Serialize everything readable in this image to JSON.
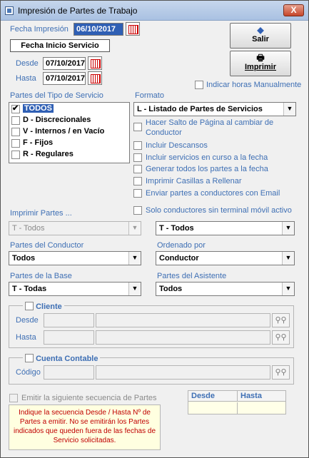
{
  "window": {
    "title": "Impresión de Partes de Trabajo",
    "close": "X"
  },
  "fecha_impresion": {
    "label": "Fecha Impresión",
    "value": "06/10/2017"
  },
  "fecha_inicio": {
    "label": "Fecha Inicio Servicio",
    "desde_label": "Desde",
    "desde": "07/10/2017",
    "hasta_label": "Hasta",
    "hasta": "07/10/2017"
  },
  "buttons": {
    "salir": "Salir",
    "imprimir": "Imprimir"
  },
  "indicar_horas": "Indicar horas Manualmente",
  "tipo_servicio": {
    "label": "Partes del Tipo de Servicio",
    "items": [
      {
        "text": "TODOS",
        "checked": true
      },
      {
        "text": "D - Discrecionales",
        "checked": false
      },
      {
        "text": "V - Internos / en Vacío",
        "checked": false
      },
      {
        "text": "F - Fijos",
        "checked": false
      },
      {
        "text": "R - Regulares",
        "checked": false
      }
    ]
  },
  "formato": {
    "label": "Formato",
    "value": "L - Listado de Partes de Servicios",
    "options": [
      "Hacer Salto de Página al cambiar de",
      "Conductor",
      "Incluir Descansos",
      "Incluir servicios en curso a la fecha",
      "Generar todos los partes a la fecha",
      "Imprimir Casillas a Rellenar",
      "Enviar partes a conductores con Email",
      "Solo conductores sin terminal móvil activo"
    ]
  },
  "imprimir_partes": {
    "label": "Imprimir Partes ...",
    "value1": "T - Todos",
    "value2": "T - Todos"
  },
  "partes_conductor": {
    "label": "Partes del Conductor",
    "value": "Todos"
  },
  "ordenado_por": {
    "label": "Ordenado por",
    "value": "Conductor"
  },
  "partes_base": {
    "label": "Partes de la Base",
    "value": "T - Todas"
  },
  "partes_asistente": {
    "label": "Partes del Asistente",
    "value": "Todos"
  },
  "cliente": {
    "title": "Cliente",
    "desde": "Desde",
    "hasta": "Hasta"
  },
  "cuenta": {
    "title": "Cuenta Contable",
    "codigo": "Código"
  },
  "secuencia": {
    "label": "Emitir la siguiente secuencia de Partes",
    "note": "Indique la secuencia Desde / Hasta Nº de Partes a emitir. No se emitirán los Partes indicados que queden fuera de las fechas de Servicio solicitadas.",
    "col_desde": "Desde",
    "col_hasta": "Hasta"
  },
  "icons": {
    "calendar": "calendar-icon",
    "binoculars": "binoculars-icon",
    "printer": "printer-icon"
  }
}
